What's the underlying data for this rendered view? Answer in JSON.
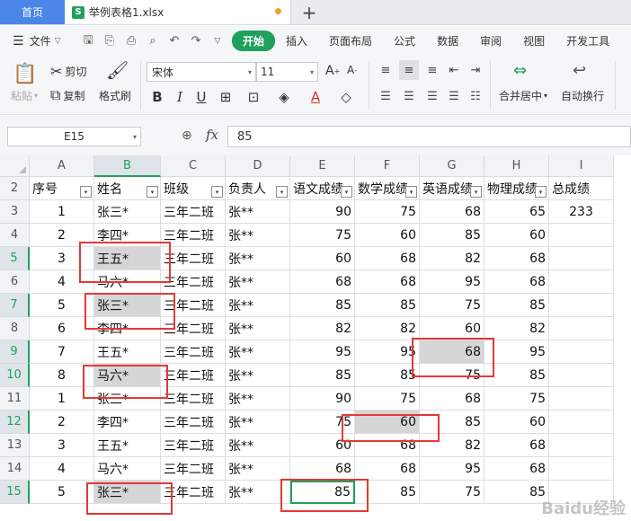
{
  "tabs": {
    "home": "首页",
    "file_name": "举例表格1.xlsx",
    "new_tab": "+"
  },
  "menu": {
    "file_label": "文件",
    "tabs": [
      "开始",
      "插入",
      "页面布局",
      "公式",
      "数据",
      "审阅",
      "视图",
      "开发工具"
    ]
  },
  "ribbon": {
    "paste": "粘贴",
    "cut": "剪切",
    "copy": "复制",
    "format_painter": "格式刷",
    "font_name": "宋体",
    "font_size": "11",
    "merge_center": "合并居中",
    "wrap_text": "自动换行"
  },
  "formula_bar": {
    "cell_ref": "E15",
    "fx": "fx",
    "value": "85"
  },
  "grid": {
    "columns": [
      "A",
      "B",
      "C",
      "D",
      "E",
      "F",
      "G",
      "H",
      "I"
    ],
    "selected_column": "B",
    "header_row": [
      "序号",
      "姓名",
      "班级",
      "负责人",
      "语文成绩",
      "数学成绩",
      "英语成绩",
      "物理成绩",
      "总成绩"
    ],
    "rows": [
      {
        "n": "3",
        "cells": [
          "1",
          "张三*",
          "三年二班",
          "张**",
          "90",
          "75",
          "68",
          "65",
          "233"
        ]
      },
      {
        "n": "4",
        "cells": [
          "2",
          "李四*",
          "三年二班",
          "张**",
          "75",
          "60",
          "85",
          "60",
          ""
        ]
      },
      {
        "n": "5",
        "cells": [
          "3",
          "王五*",
          "三年二班",
          "张**",
          "60",
          "68",
          "82",
          "68",
          ""
        ]
      },
      {
        "n": "6",
        "cells": [
          "4",
          "马六*",
          "三年二班",
          "张**",
          "68",
          "68",
          "95",
          "68",
          ""
        ]
      },
      {
        "n": "7",
        "cells": [
          "5",
          "张三*",
          "三年二班",
          "张**",
          "85",
          "85",
          "75",
          "85",
          ""
        ]
      },
      {
        "n": "8",
        "cells": [
          "6",
          "李四*",
          "三年二班",
          "张**",
          "82",
          "82",
          "60",
          "82",
          ""
        ]
      },
      {
        "n": "9",
        "cells": [
          "7",
          "王五*",
          "三年二班",
          "张**",
          "95",
          "95",
          "68",
          "95",
          ""
        ]
      },
      {
        "n": "10",
        "cells": [
          "8",
          "马六*",
          "三年二班",
          "张**",
          "85",
          "85",
          "75",
          "85",
          ""
        ]
      },
      {
        "n": "11",
        "cells": [
          "1",
          "张三*",
          "三年二班",
          "张**",
          "90",
          "75",
          "68",
          "75",
          ""
        ]
      },
      {
        "n": "12",
        "cells": [
          "2",
          "李四*",
          "三年二班",
          "张**",
          "75",
          "60",
          "85",
          "60",
          ""
        ]
      },
      {
        "n": "13",
        "cells": [
          "3",
          "王五*",
          "三年二班",
          "张**",
          "60",
          "68",
          "82",
          "68",
          ""
        ]
      },
      {
        "n": "14",
        "cells": [
          "4",
          "马六*",
          "三年二班",
          "张**",
          "68",
          "68",
          "95",
          "68",
          ""
        ]
      },
      {
        "n": "15",
        "cells": [
          "5",
          "张三*",
          "三年二班",
          "张**",
          "85",
          "85",
          "75",
          "85",
          ""
        ]
      }
    ],
    "selected_rows": [
      "5",
      "7",
      "9",
      "10",
      "12",
      "15"
    ],
    "highlighted_cells": [
      "B5",
      "B7",
      "B10",
      "G9",
      "F12",
      "B15"
    ],
    "active_cell": "E15",
    "annotation_color": "#e53935",
    "highlight_color": "#d6d6d6"
  },
  "watermark": "Baidu经验"
}
